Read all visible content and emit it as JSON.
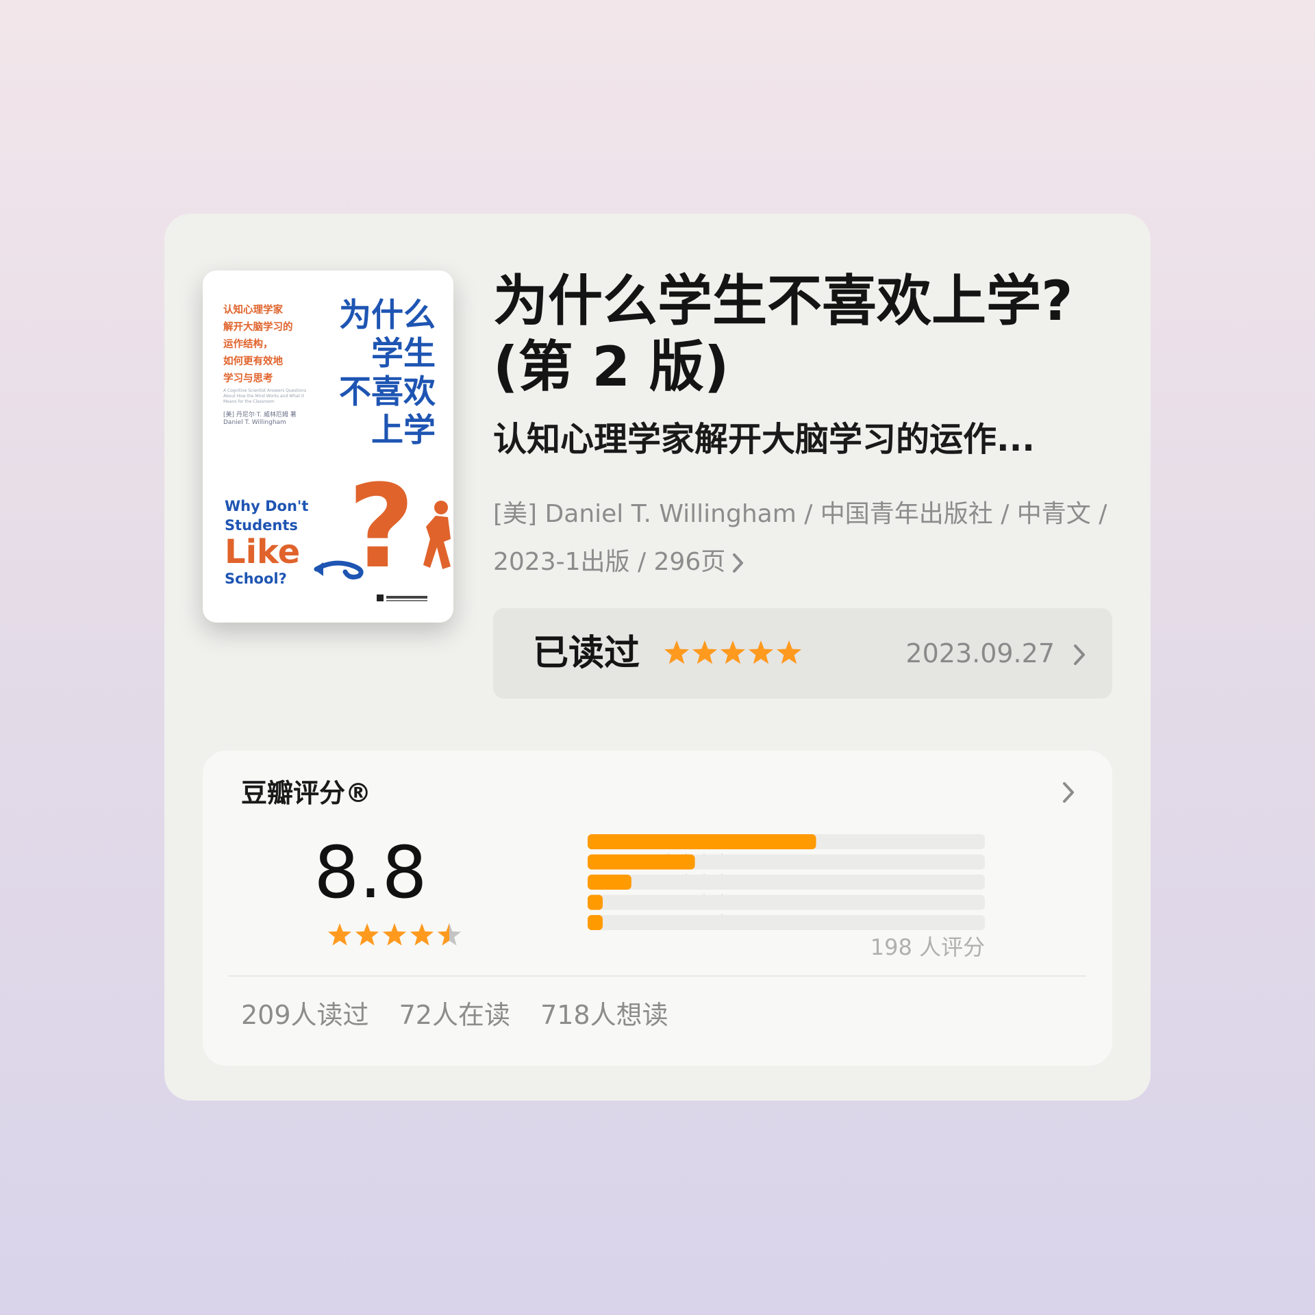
{
  "book": {
    "cover": {
      "tagline_lines": [
        "认知心理学家",
        "解开大脑学习的",
        "运作结构，",
        "如何更有效地",
        "学习与思考"
      ],
      "tagline_en": "A Cognitive Scientist Answers Questions About How the Mind Works and What It Means for the Classroom",
      "author_lines": [
        "[美] 丹尼尔·T. 威林厄姆 著",
        "Daniel T. Willingham"
      ],
      "title_lines": [
        "为什么",
        "学生",
        "不喜欢",
        "上学"
      ],
      "title_en_lines": [
        "Why Don't",
        "Students"
      ],
      "title_en_big": "Like",
      "title_en_last": "School?",
      "question_mark": "?",
      "accent_orange": "#e0632b",
      "accent_blue": "#1e55b3"
    },
    "title_lines": [
      "为什么学生不喜欢上学?",
      "(第 2 版)"
    ],
    "subtitle": "认知心理学家解开大脑学习的运作...",
    "meta": "[美] Daniel T. Willingham / 中国青年出版社 / 中青文 / 2023-1出版 / 296页"
  },
  "read_status": {
    "label": "已读过",
    "user_rating": 5,
    "date": "2023.09.27",
    "star_color": "#ff9a1f"
  },
  "douban_score": {
    "title": "豆瓣评分®",
    "score": "8.8",
    "score_stars": 4.5,
    "distribution": [
      {
        "stars": 5,
        "fraction": 0.575
      },
      {
        "stars": 4,
        "fraction": 0.27
      },
      {
        "stars": 3,
        "fraction": 0.11
      },
      {
        "stars": 2,
        "fraction": 0.035
      },
      {
        "stars": 1,
        "fraction": 0.035
      }
    ],
    "rating_count": "198 人评分",
    "bar_color": "#ff9a00",
    "track_color": "#ebebe9"
  },
  "stats": {
    "read": "209人读过",
    "reading": "72人在读",
    "want": "718人想读"
  }
}
